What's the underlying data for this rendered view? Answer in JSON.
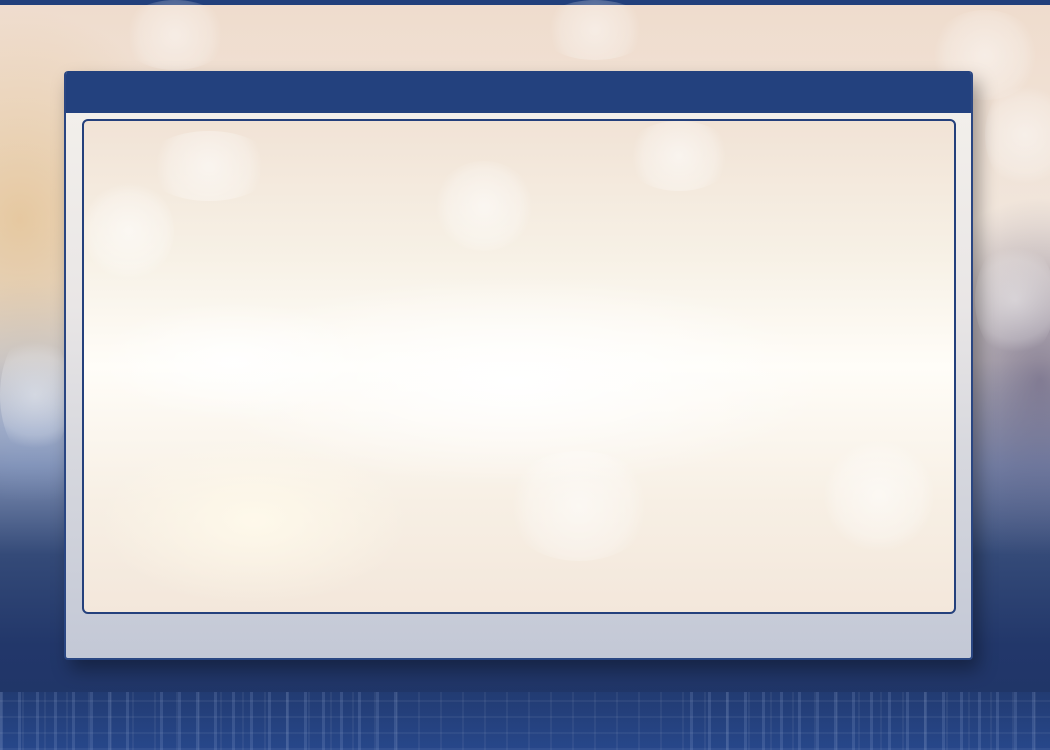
{
  "dialog": {
    "title": "",
    "content": "",
    "footer": ""
  },
  "colors": {
    "header": "#23417e",
    "border": "#24407c",
    "background_bottom": "#1e3466"
  }
}
